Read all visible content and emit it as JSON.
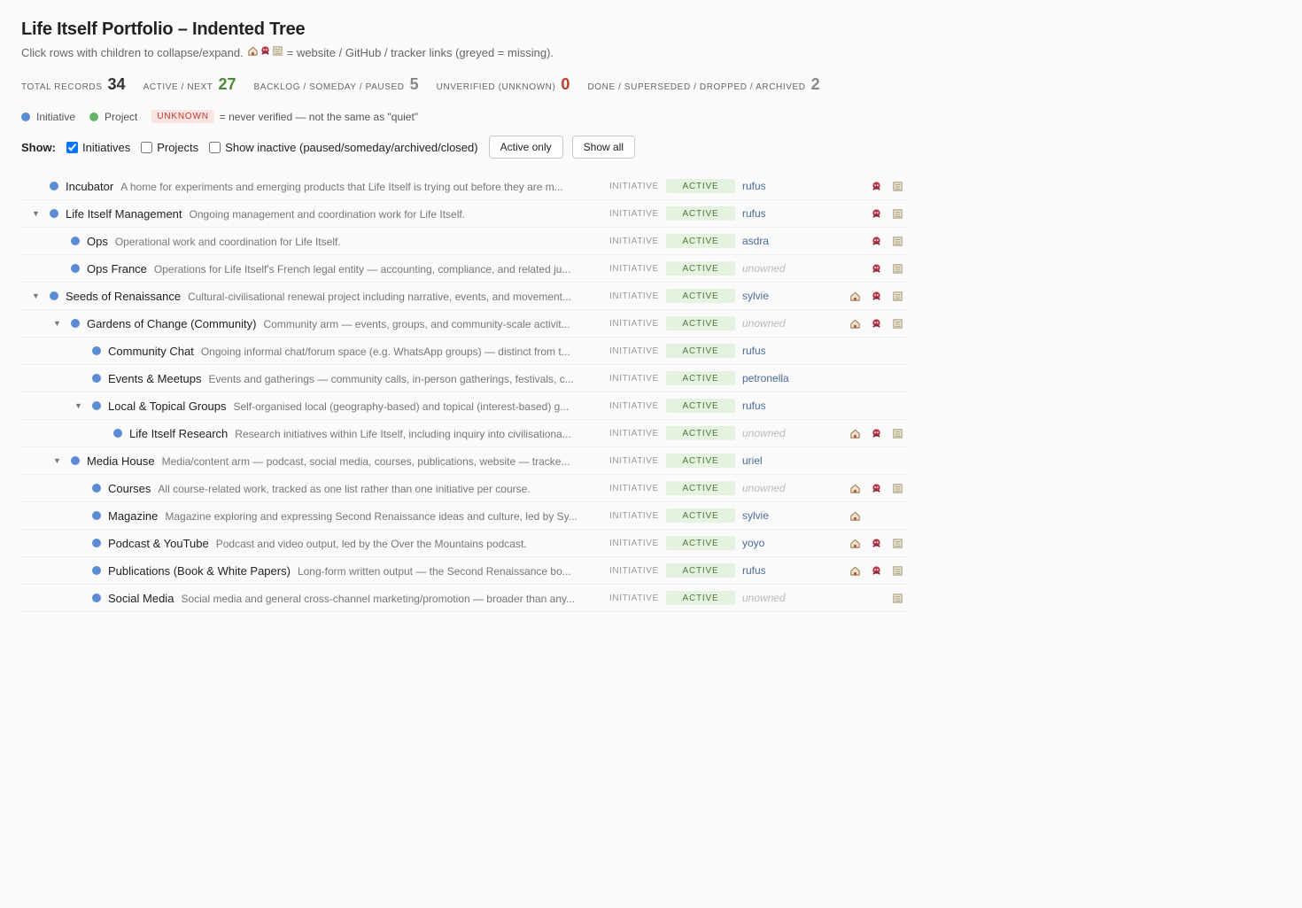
{
  "header": {
    "title": "Life Itself Portfolio – Indented Tree",
    "subtitle_pre": "Click rows with children to collapse/expand.",
    "subtitle_post": "= website / GitHub / tracker links (greyed = missing)."
  },
  "stats": [
    {
      "label": "Total records",
      "value": "34",
      "kind": "total"
    },
    {
      "label": "Active / Next",
      "value": "27",
      "kind": "active"
    },
    {
      "label": "Backlog / Someday / Paused",
      "value": "5",
      "kind": "backlog"
    },
    {
      "label": "Unverified (unknown)",
      "value": "0",
      "kind": "unverified"
    },
    {
      "label": "Done / Superseded / Dropped / Archived",
      "value": "2",
      "kind": "done"
    }
  ],
  "legend": {
    "initiative": "Initiative",
    "project": "Project",
    "unknown_badge": "UNKNOWN",
    "unknown_note": "= never verified — not the same as \"quiet\""
  },
  "filters": {
    "show_label": "Show:",
    "initiatives_label": "Initiatives",
    "initiatives_checked": true,
    "projects_label": "Projects",
    "projects_checked": false,
    "inactive_label": "Show inactive (paused/someday/archived/closed)",
    "inactive_checked": false,
    "active_only_button": "Active only",
    "show_all_button": "Show all"
  },
  "colors": {
    "initiative_dot": "#5b8bd4",
    "project_dot": "#66b36a",
    "active_status_bg": "#e6f2e0",
    "unknown_red": "#c0392b"
  },
  "rows": [
    {
      "depth": 0,
      "toggle": "",
      "name": "Incubator",
      "desc": "A home for experiments and emerging products that Life Itself is trying out before they are m...",
      "type": "INITIATIVE",
      "status": "ACTIVE",
      "owner": "rufus",
      "owned": true,
      "web": false,
      "gh": true,
      "tr": true
    },
    {
      "depth": 0,
      "toggle": "▼",
      "name": "Life Itself Management",
      "desc": "Ongoing management and coordination work for Life Itself.",
      "type": "INITIATIVE",
      "status": "ACTIVE",
      "owner": "rufus",
      "owned": true,
      "web": false,
      "gh": true,
      "tr": true
    },
    {
      "depth": 1,
      "toggle": "",
      "name": "Ops",
      "desc": "Operational work and coordination for Life Itself.",
      "type": "INITIATIVE",
      "status": "ACTIVE",
      "owner": "asdra",
      "owned": true,
      "web": false,
      "gh": true,
      "tr": true
    },
    {
      "depth": 1,
      "toggle": "",
      "name": "Ops France",
      "desc": "Operations for Life Itself's French legal entity — accounting, compliance, and related ju...",
      "type": "INITIATIVE",
      "status": "ACTIVE",
      "owner": "unowned",
      "owned": false,
      "web": false,
      "gh": true,
      "tr": true
    },
    {
      "depth": 0,
      "toggle": "▼",
      "name": "Seeds of Renaissance",
      "desc": "Cultural-civilisational renewal project including narrative, events, and movement...",
      "type": "INITIATIVE",
      "status": "ACTIVE",
      "owner": "sylvie",
      "owned": true,
      "web": true,
      "gh": true,
      "tr": true
    },
    {
      "depth": 1,
      "toggle": "▼",
      "name": "Gardens of Change (Community)",
      "desc": "Community arm — events, groups, and community-scale activit...",
      "type": "INITIATIVE",
      "status": "ACTIVE",
      "owner": "unowned",
      "owned": false,
      "web": true,
      "gh": true,
      "tr": true
    },
    {
      "depth": 2,
      "toggle": "",
      "name": "Community Chat",
      "desc": "Ongoing informal chat/forum space (e.g. WhatsApp groups) — distinct from t...",
      "type": "INITIATIVE",
      "status": "ACTIVE",
      "owner": "rufus",
      "owned": true,
      "web": false,
      "gh": false,
      "tr": false
    },
    {
      "depth": 2,
      "toggle": "",
      "name": "Events & Meetups",
      "desc": "Events and gatherings — community calls, in-person gatherings, festivals, c...",
      "type": "INITIATIVE",
      "status": "ACTIVE",
      "owner": "petronella",
      "owned": true,
      "web": false,
      "gh": false,
      "tr": false
    },
    {
      "depth": 2,
      "toggle": "▼",
      "name": "Local & Topical Groups",
      "desc": "Self-organised local (geography-based) and topical (interest-based) g...",
      "type": "INITIATIVE",
      "status": "ACTIVE",
      "owner": "rufus",
      "owned": true,
      "web": false,
      "gh": false,
      "tr": false
    },
    {
      "depth": 3,
      "toggle": "",
      "name": "Life Itself Research",
      "desc": "Research initiatives within Life Itself, including inquiry into civilisationa...",
      "type": "INITIATIVE",
      "status": "ACTIVE",
      "owner": "unowned",
      "owned": false,
      "web": true,
      "gh": true,
      "tr": true
    },
    {
      "depth": 1,
      "toggle": "▼",
      "name": "Media House",
      "desc": "Media/content arm — podcast, social media, courses, publications, website — tracke...",
      "type": "INITIATIVE",
      "status": "ACTIVE",
      "owner": "uriel",
      "owned": true,
      "web": false,
      "gh": false,
      "tr": false
    },
    {
      "depth": 2,
      "toggle": "",
      "name": "Courses",
      "desc": "All course-related work, tracked as one list rather than one initiative per course.",
      "type": "INITIATIVE",
      "status": "ACTIVE",
      "owner": "unowned",
      "owned": false,
      "web": true,
      "gh": true,
      "tr": true
    },
    {
      "depth": 2,
      "toggle": "",
      "name": "Magazine",
      "desc": "Magazine exploring and expressing Second Renaissance ideas and culture, led by Sy...",
      "type": "INITIATIVE",
      "status": "ACTIVE",
      "owner": "sylvie",
      "owned": true,
      "web": true,
      "gh": false,
      "tr": false
    },
    {
      "depth": 2,
      "toggle": "",
      "name": "Podcast & YouTube",
      "desc": "Podcast and video output, led by the Over the Mountains podcast.",
      "type": "INITIATIVE",
      "status": "ACTIVE",
      "owner": "yoyo",
      "owned": true,
      "web": true,
      "gh": true,
      "tr": true
    },
    {
      "depth": 2,
      "toggle": "",
      "name": "Publications (Book & White Papers)",
      "desc": "Long-form written output — the Second Renaissance bo...",
      "type": "INITIATIVE",
      "status": "ACTIVE",
      "owner": "rufus",
      "owned": true,
      "web": true,
      "gh": true,
      "tr": true
    },
    {
      "depth": 2,
      "toggle": "",
      "name": "Social Media",
      "desc": "Social media and general cross-channel marketing/promotion — broader than any...",
      "type": "INITIATIVE",
      "status": "ACTIVE",
      "owner": "unowned",
      "owned": false,
      "web": false,
      "gh": false,
      "tr": true
    }
  ]
}
